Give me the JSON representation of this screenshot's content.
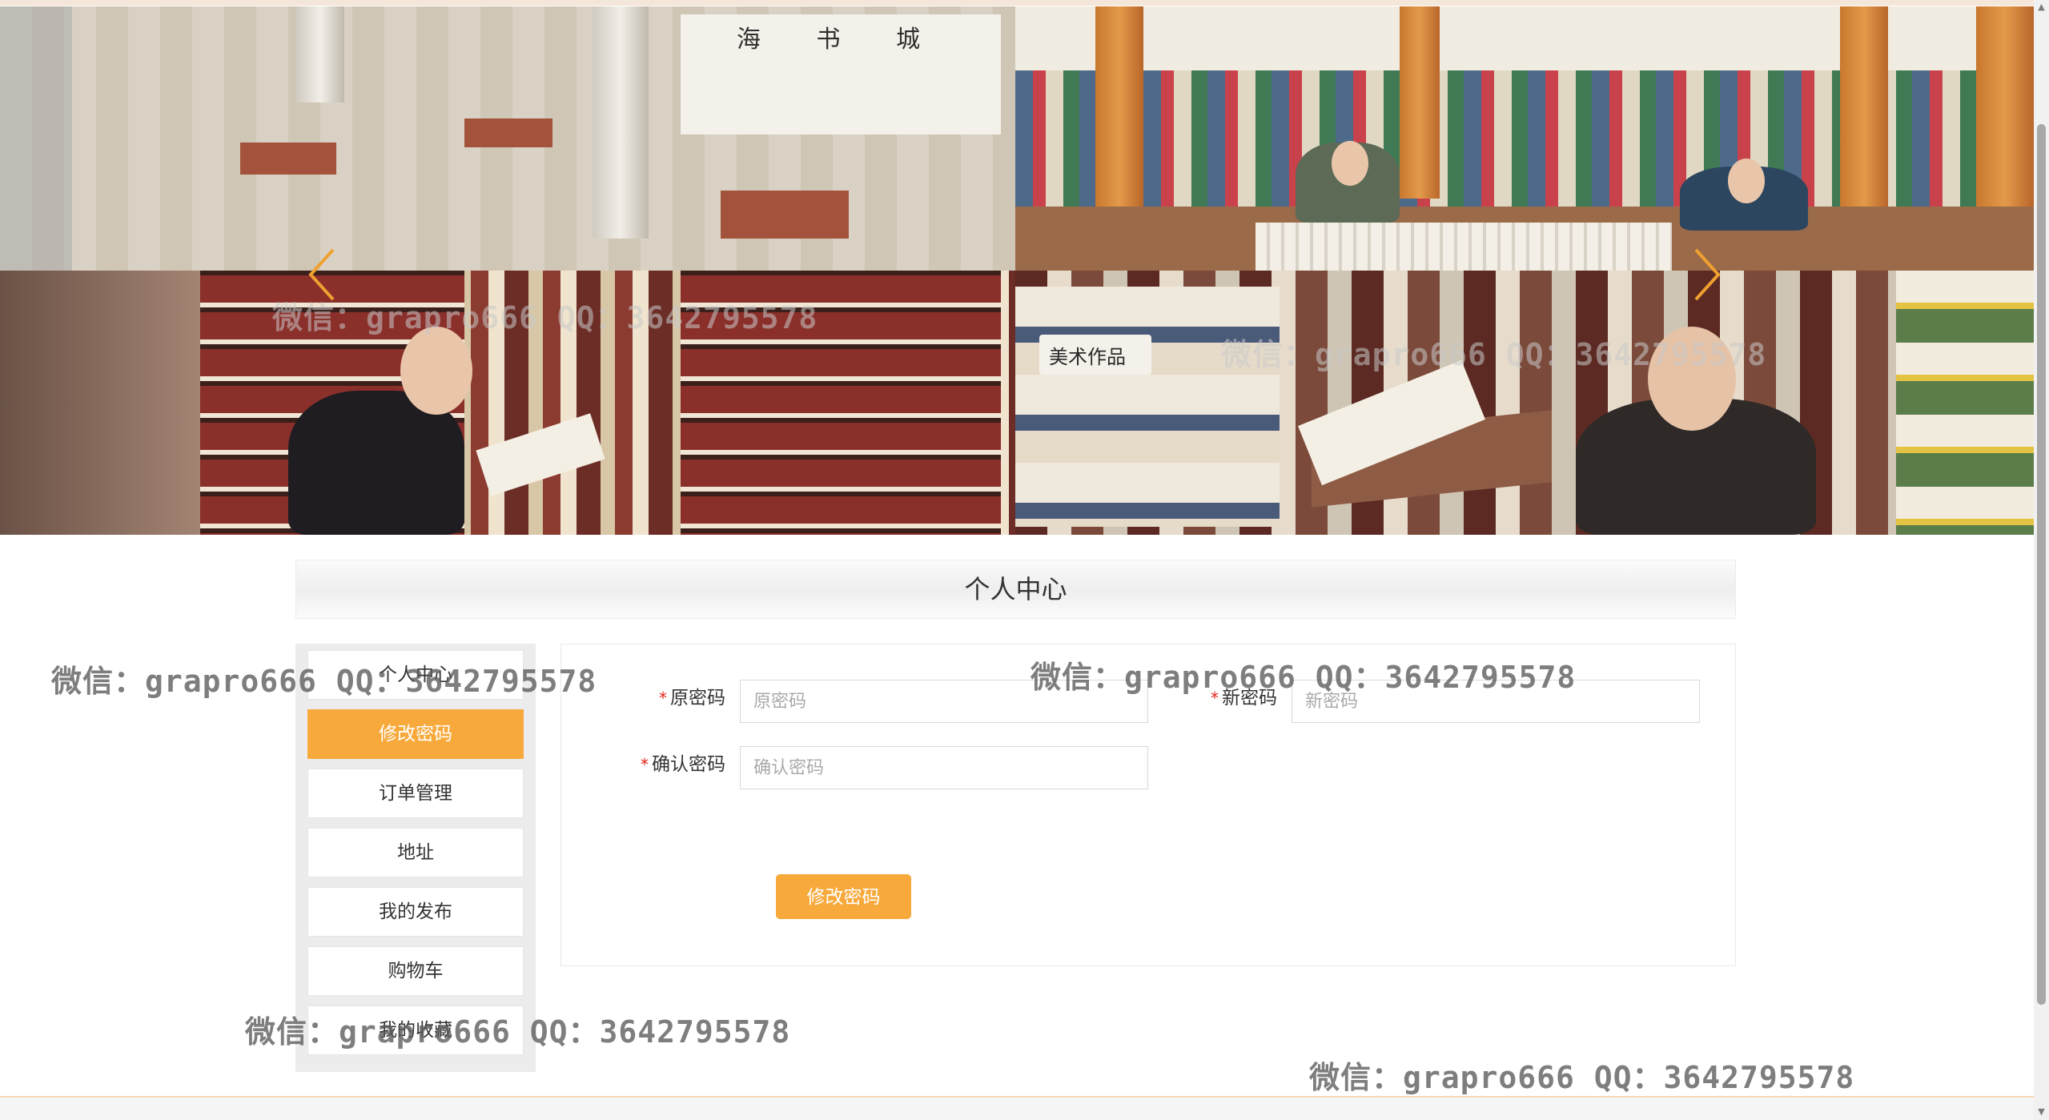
{
  "banner": {
    "prev_icon": "chevron-left-icon",
    "next_icon": "chevron-right-icon",
    "photo_caption_sign": "美术作品",
    "store_sign": "海 书 城"
  },
  "section": {
    "title": "个人中心"
  },
  "sidebar": {
    "items": [
      {
        "label": "个人中心",
        "active": false
      },
      {
        "label": "修改密码",
        "active": true
      },
      {
        "label": "订单管理",
        "active": false
      },
      {
        "label": "地址",
        "active": false
      },
      {
        "label": "我的发布",
        "active": false
      },
      {
        "label": "购物车",
        "active": false
      },
      {
        "label": "我的收藏",
        "active": false
      }
    ]
  },
  "form": {
    "old_password": {
      "label": "原密码",
      "placeholder": "原密码",
      "value": ""
    },
    "new_password": {
      "label": "新密码",
      "placeholder": "新密码",
      "value": ""
    },
    "confirm_password": {
      "label": "确认密码",
      "placeholder": "确认密码",
      "value": ""
    },
    "required_mark": "*",
    "submit_label": "修改密码"
  },
  "watermark": {
    "text": "微信：grapro666 QQ：3642795578"
  },
  "colors": {
    "accent": "#f7a93b",
    "required": "#e2231a",
    "title_bar": "#eeeeee"
  }
}
